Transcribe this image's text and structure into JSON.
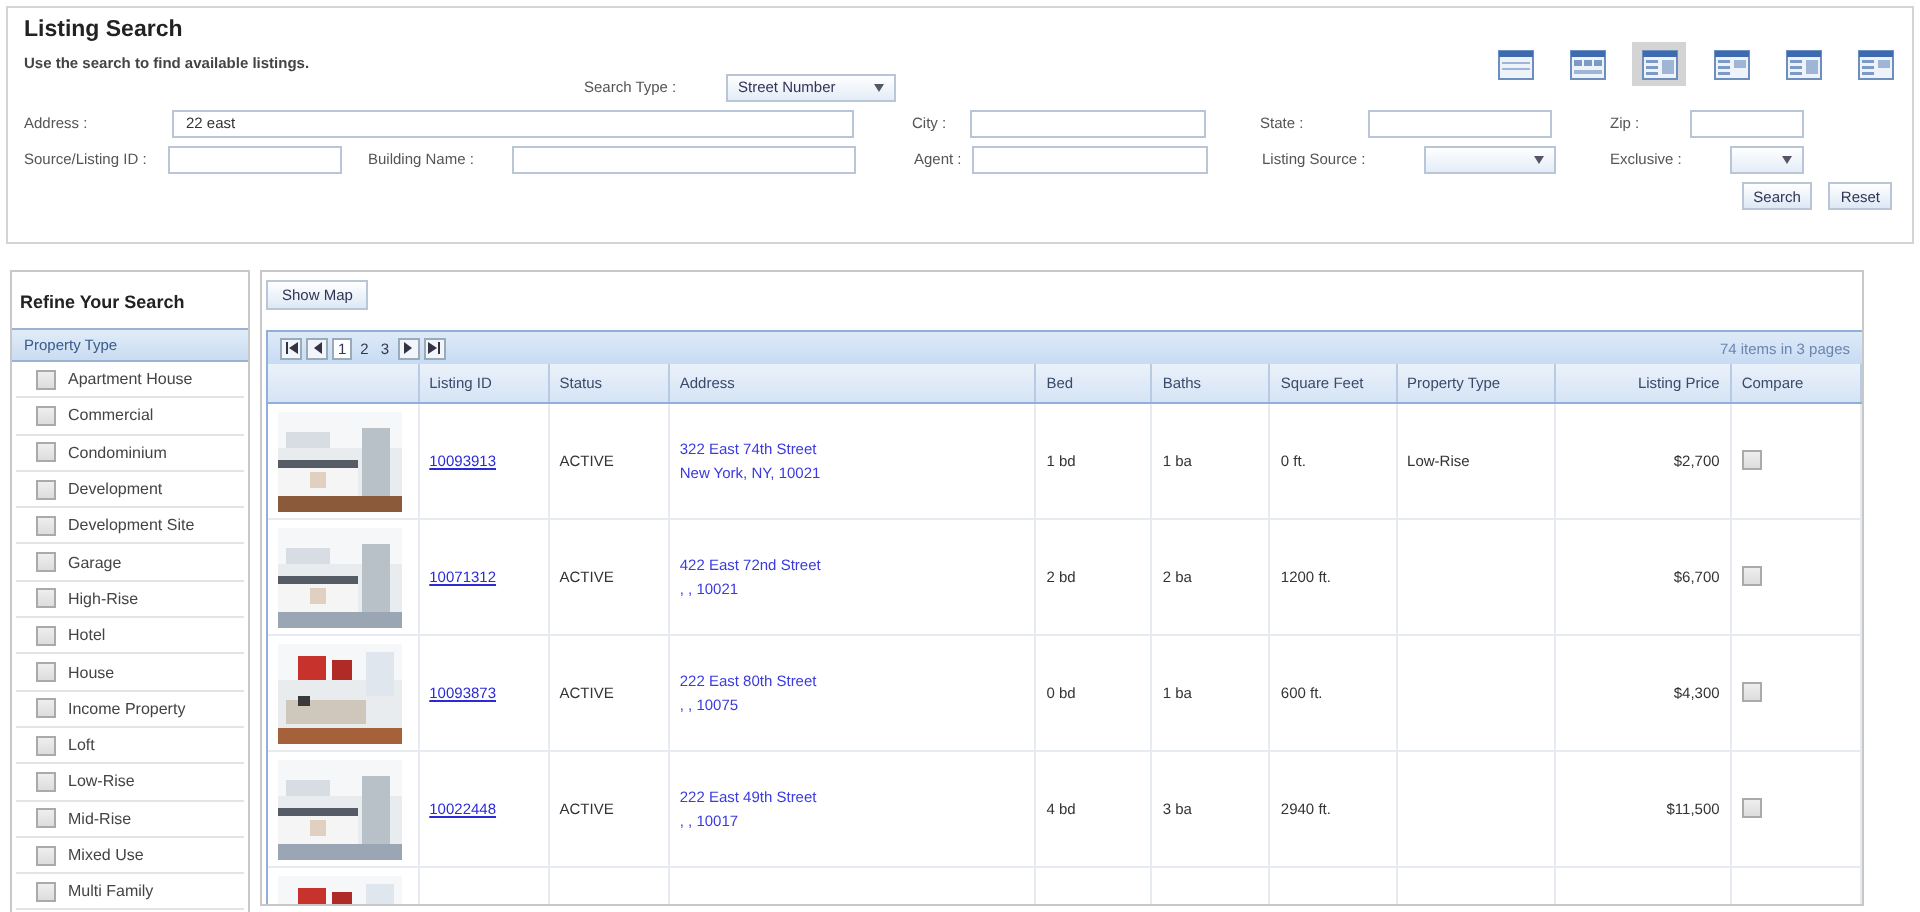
{
  "header": {
    "title": "Listing Search",
    "subtitle": "Use the search to find available listings."
  },
  "views": [
    {
      "selected": false
    },
    {
      "selected": false
    },
    {
      "selected": true
    },
    {
      "selected": false
    },
    {
      "selected": false
    },
    {
      "selected": false
    }
  ],
  "search_type": {
    "label": "Search Type :",
    "value": "Street Number"
  },
  "form": {
    "address": {
      "label": "Address :",
      "value": "22 east"
    },
    "city": {
      "label": "City :"
    },
    "state": {
      "label": "State :"
    },
    "zip": {
      "label": "Zip :"
    },
    "source_id": {
      "label": "Source/Listing ID :"
    },
    "building": {
      "label": "Building Name :"
    },
    "agent": {
      "label": "Agent :"
    },
    "listing_source": {
      "label": "Listing Source :"
    },
    "exclusive": {
      "label": "Exclusive :"
    }
  },
  "buttons": [
    "Search",
    "Reset"
  ],
  "sidebar": {
    "title": "Refine Your Search",
    "section": "Property Type",
    "items": [
      {
        "label": "Apartment House",
        "checked": false
      },
      {
        "label": "Commercial",
        "checked": false
      },
      {
        "label": "Condominium",
        "checked": false
      },
      {
        "label": "Development",
        "checked": false
      },
      {
        "label": "Development Site",
        "checked": false
      },
      {
        "label": "Garage",
        "checked": false
      },
      {
        "label": "High-Rise",
        "checked": false
      },
      {
        "label": "Hotel",
        "checked": false
      },
      {
        "label": "House",
        "checked": false
      },
      {
        "label": "Income Property",
        "checked": false
      },
      {
        "label": "Loft",
        "checked": false
      },
      {
        "label": "Low-Rise",
        "checked": false
      },
      {
        "label": "Mid-Rise",
        "checked": false
      },
      {
        "label": "Mixed Use",
        "checked": false
      },
      {
        "label": "Multi Family",
        "checked": false
      }
    ]
  },
  "show_map": "Show Map",
  "pager": {
    "pages": [
      {
        "label": "1",
        "selected": true
      },
      {
        "label": "2",
        "selected": false
      },
      {
        "label": "3",
        "selected": false
      }
    ],
    "summary": "74 items in 3 pages"
  },
  "table": {
    "columns": [
      "Listing ID",
      "Status",
      "Address",
      "Bed",
      "Baths",
      "Square Feet",
      "Property Type",
      "Listing Price",
      "Compare"
    ],
    "rows": [
      {
        "photo": {
          "kind": "picture"
        },
        "id": "10093913",
        "status": "ACTIVE",
        "street": "322 East 74th Street",
        "locality": "New York, NY, 10021",
        "bed": "1 bd",
        "baths": "1 ba",
        "sqft": "0 ft.",
        "type": "Low-Rise",
        "price": "$2,700",
        "compare": false
      },
      {
        "photo": {
          "kind": "picture"
        },
        "id": "10071312",
        "status": "ACTIVE",
        "street": "422 East 72nd Street",
        "locality": ", , 10021",
        "bed": "2 bd",
        "baths": "2 ba",
        "sqft": "1200 ft.",
        "price": "$6,700",
        "compare": false
      },
      {
        "photo": {
          "kind": "picture"
        },
        "id": "10093873",
        "status": "ACTIVE",
        "street": "222 East 80th Street",
        "locality": ", , 10075",
        "bed": "0 bd",
        "baths": "1 ba",
        "sqft": "600 ft.",
        "price": "$4,300",
        "compare": false
      },
      {
        "photo": {
          "kind": "picture"
        },
        "id": "10022448",
        "status": "ACTIVE",
        "street": "222 East 49th Street",
        "locality": ", , 10017",
        "bed": "4 bd",
        "baths": "3 ba",
        "sqft": "2940 ft.",
        "price": "$11,500",
        "compare": false
      },
      {
        "photo": {
          "kind": "picture"
        }
      }
    ]
  }
}
